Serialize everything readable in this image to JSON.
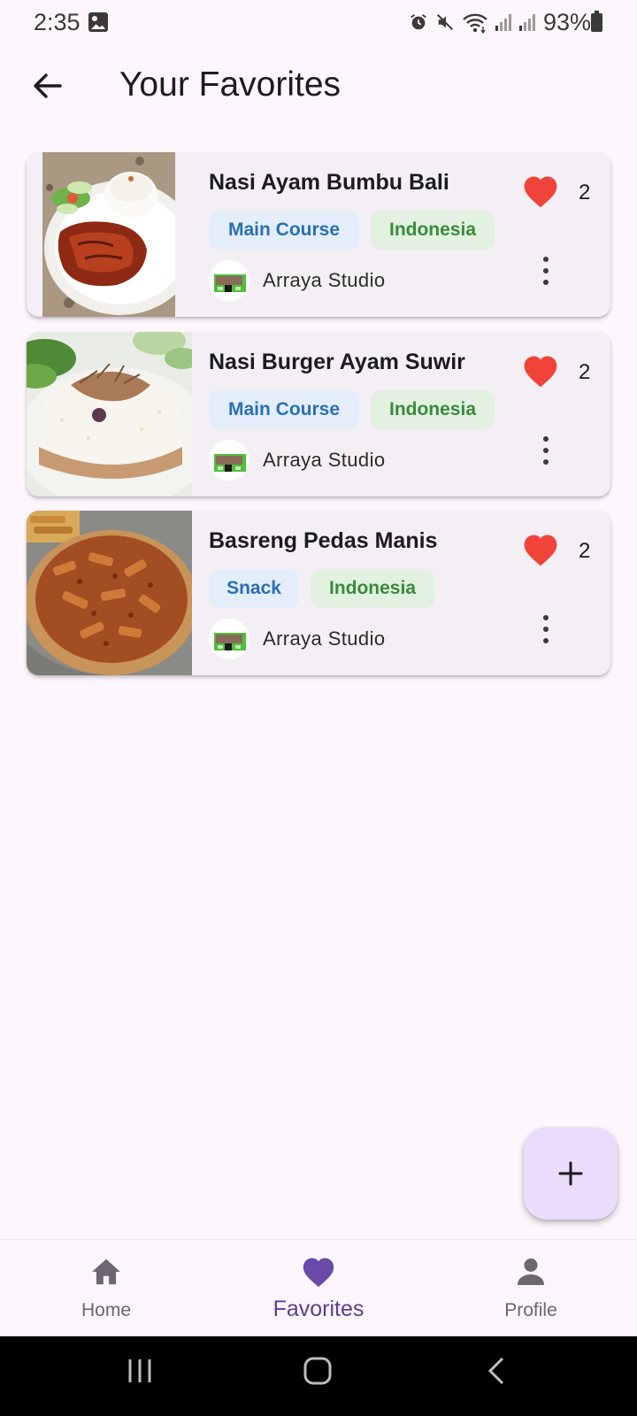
{
  "status_bar": {
    "time": "2:35",
    "battery": "93%",
    "icons": [
      "gallery-icon",
      "alarm-icon",
      "mute-icon",
      "wifi-icon",
      "signal-icon",
      "signal-icon",
      "battery-icon"
    ]
  },
  "app_bar": {
    "title": "Your Favorites",
    "back_icon": "arrow-back-icon"
  },
  "favorites": [
    {
      "title": "Nasi Ayam Bumbu Bali",
      "category": "Main Course",
      "country": "Indonesia",
      "author": "Arraya Studio",
      "likes": "2",
      "image": "grilled-chicken-rice-plate"
    },
    {
      "title": "Nasi Burger Ayam Suwir",
      "category": "Main Course",
      "country": "Indonesia",
      "author": "Arraya Studio",
      "likes": "2",
      "image": "rice-mound-shredded-chicken"
    },
    {
      "title": "Basreng Pedas Manis",
      "category": "Snack",
      "country": "Indonesia",
      "author": "Arraya Studio",
      "likes": "2",
      "image": "spicy-fried-fishball-strips"
    }
  ],
  "fab": {
    "icon": "plus-icon"
  },
  "bottom_nav": {
    "items": [
      {
        "label": "Home",
        "icon": "home-icon",
        "active": false
      },
      {
        "label": "Favorites",
        "icon": "heart-icon",
        "active": true
      },
      {
        "label": "Profile",
        "icon": "person-icon",
        "active": false
      }
    ]
  },
  "colors": {
    "background": "#fdf6fc",
    "card": "#f4eff4",
    "heart": "#f0443a",
    "category_tag_bg": "#e3eefa",
    "category_tag_text": "#2a6fb5",
    "country_tag_bg": "#e2f1e0",
    "country_tag_text": "#3b8a3e",
    "active_nav": "#5a3f8f",
    "fab": "#eaddfb"
  }
}
